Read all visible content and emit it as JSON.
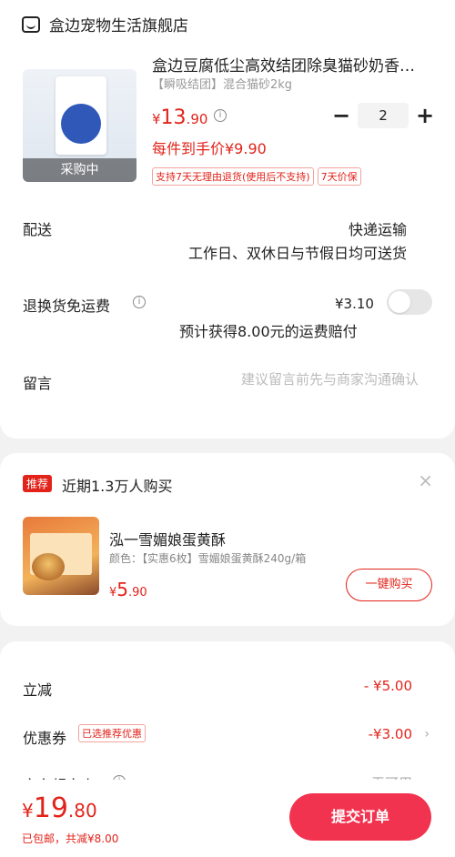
{
  "shop": {
    "name": "盒边宠物生活旗舰店"
  },
  "product": {
    "title": "盒边豆腐低尘高效结团除臭猫砂奶香…",
    "spec": "【瞬吸结团】混合猫砂2kg",
    "image_label": "采购中",
    "price_currency": "¥",
    "price_int": "13",
    "price_dec": ".90",
    "quantity": "2",
    "per_item_price": "每件到手价¥9.90",
    "tags": [
      "支持7天无理由退货(使用后不支持)",
      "7天价保"
    ]
  },
  "delivery": {
    "label": "配送",
    "method": "快递运输",
    "note": "工作日、双休日与节假日均可送货"
  },
  "return_shipping": {
    "label": "退换货免运费",
    "price": "¥3.10",
    "note": "预计获得8.00元的运费赔付",
    "enabled": false
  },
  "memo": {
    "label": "留言",
    "placeholder": "建议留言前先与商家沟通确认"
  },
  "recommend": {
    "badge": "推荐",
    "title": "近期1.3万人购买",
    "close": "×",
    "product_name": "泓一雪媚娘蛋黄酥",
    "product_spec": "颜色：【实惠6枚】雪媚娘蛋黄酥240g/箱",
    "price_currency": "¥",
    "price_int": "5",
    "price_dec": ".90",
    "buy_label": "一键购买"
  },
  "summary": {
    "discount_label": "立减",
    "discount_value": "- ¥5.00",
    "coupon_label": "优惠券",
    "coupon_tag": "已选推荐优惠",
    "coupon_value": "-¥3.00",
    "jd_card_label": "京东超市卡",
    "jd_card_value": "无可用"
  },
  "bottom": {
    "total_currency": "¥",
    "total_int": "19",
    "total_dec": ".80",
    "sub": "已包邮，共减¥8.00",
    "submit_label": "提交订单"
  },
  "colors": {
    "accent": "#e2231a",
    "submit": "#f2334f"
  }
}
